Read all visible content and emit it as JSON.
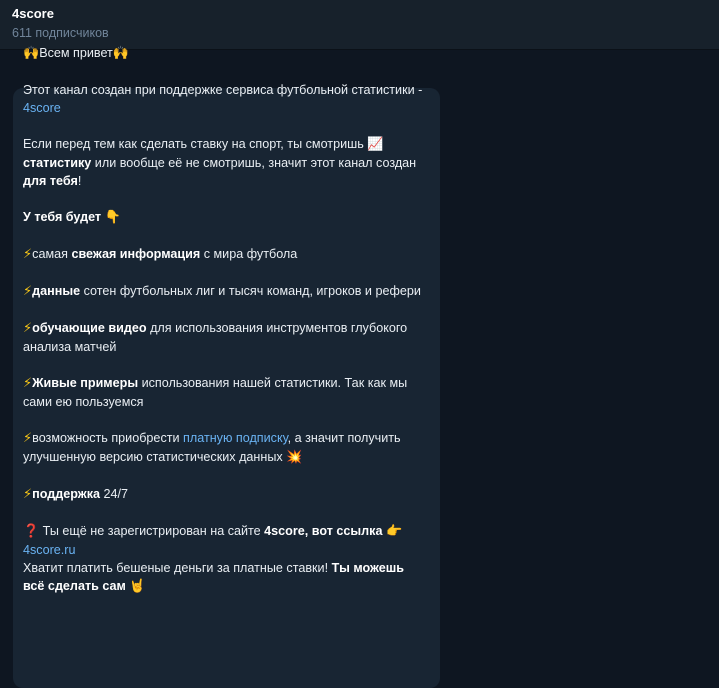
{
  "header": {
    "title": "4score",
    "subscribers": "611 подписчиков"
  },
  "message": {
    "greeting": {
      "icon_left": "🙌",
      "text": "Всем привет",
      "icon_right": "🙌"
    },
    "p1": {
      "text": "Этот канал создан при поддержке сервиса футбольной статистики - ",
      "link": "4score"
    },
    "p2": {
      "t1": "Если перед тем как сделать ставку на спорт, ты смотришь ",
      "icon": "📈",
      "t2": " ",
      "b1": "статистику",
      "t3": " или вообще её не смотришь,  значит этот канал создан ",
      "b2": "для тебя",
      "t4": "!"
    },
    "p3": {
      "b": "У тебя будет",
      "icon": "👇"
    },
    "bolt": "⚡",
    "item1": {
      "t1": "самая ",
      "b": "свежая информация",
      "t2": " с мира футбола"
    },
    "item2": {
      "b": "данные",
      "t": " сотен футбольных лиг и тысяч команд, игроков и рефери"
    },
    "item3": {
      "b": "обучающие видео",
      "t": " для использования  инструментов глубокого анализа матчей"
    },
    "item4": {
      "b": "Живые примеры",
      "t": " использования нашей статистики. Так как мы сами ею пользуемся"
    },
    "item5": {
      "t1": "возможность приобрести ",
      "link": "платную подписку",
      "t2": ", а значит получить улучшенную версию статистических данных ",
      "icon": "💥"
    },
    "item6": {
      "b": "поддержка",
      "t": "  24/7"
    },
    "cta": {
      "icon": "❓",
      "t1": " Ты ещё не зарегистрирован на сайте ",
      "b1": "4score, вот ссылка",
      "icon2": "👉",
      "link": "4score.ru",
      "t2": "Хватит платить бешеные деньги за платные ставки! ",
      "b2": "Ты можешь всё сделать сам",
      "icon3": "🤘"
    }
  }
}
